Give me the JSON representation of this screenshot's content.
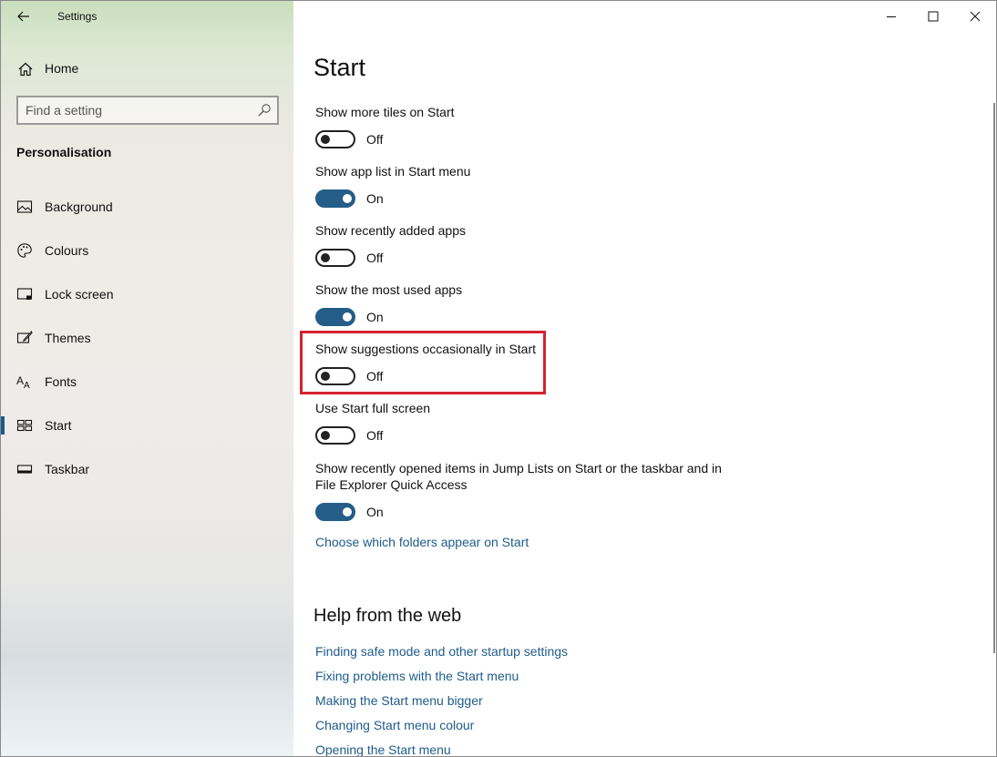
{
  "window": {
    "title": "Settings",
    "controls": {
      "minimize_icon": "minimize-icon",
      "maximize_icon": "maximize-icon",
      "close_icon": "close-icon"
    }
  },
  "sidebar": {
    "home_label": "Home",
    "search_placeholder": "Find a setting",
    "section_title": "Personalisation",
    "items": [
      {
        "label": "Background",
        "icon": "picture-icon",
        "selected": false
      },
      {
        "label": "Colours",
        "icon": "palette-icon",
        "selected": false
      },
      {
        "label": "Lock screen",
        "icon": "lock-screen-icon",
        "selected": false
      },
      {
        "label": "Themes",
        "icon": "brush-icon",
        "selected": false
      },
      {
        "label": "Fonts",
        "icon": "font-icon",
        "selected": false
      },
      {
        "label": "Start",
        "icon": "start-tiles-icon",
        "selected": true
      },
      {
        "label": "Taskbar",
        "icon": "taskbar-icon",
        "selected": false
      }
    ]
  },
  "main": {
    "title": "Start",
    "settings": [
      {
        "label": "Show more tiles on Start",
        "state": "Off",
        "on": false
      },
      {
        "label": "Show app list in Start menu",
        "state": "On",
        "on": true
      },
      {
        "label": "Show recently added apps",
        "state": "Off",
        "on": false
      },
      {
        "label": "Show the most used apps",
        "state": "On",
        "on": true
      },
      {
        "label": "Show suggestions occasionally in Start",
        "state": "Off",
        "on": false
      },
      {
        "label": "Use Start full screen",
        "state": "Off",
        "on": false
      },
      {
        "label_line1": "Show recently opened items in Jump Lists on Start or the taskbar and in",
        "label_line2": "File Explorer Quick Access",
        "state": "On",
        "on": true
      }
    ],
    "folders_link": "Choose which folders appear on Start",
    "help_title": "Help from the web",
    "help_links": [
      "Finding safe mode and other startup settings",
      "Fixing problems with the Start menu",
      "Making the Start menu bigger",
      "Changing Start menu colour",
      "Opening the Start menu"
    ]
  },
  "colors": {
    "accent": "#245d88",
    "link": "#1f5b8a",
    "highlight": "#d4232f"
  }
}
